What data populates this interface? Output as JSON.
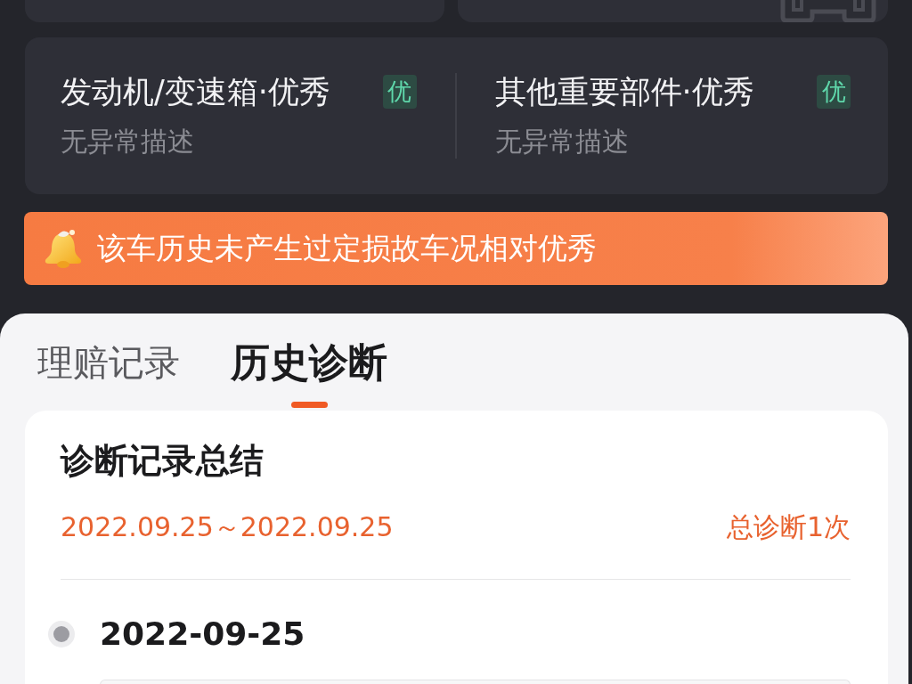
{
  "inspection": {
    "items": [
      {
        "title": "发动机/变速箱·优秀",
        "grade": "优",
        "description": "无异常描述"
      },
      {
        "title": "其他重要部件·优秀",
        "grade": "优",
        "description": "无异常描述"
      }
    ]
  },
  "notice": {
    "text": "该车历史未产生过定损故车况相对优秀"
  },
  "tabs": [
    {
      "label": "理赔记录",
      "selected": false
    },
    {
      "label": "历史诊断",
      "selected": true
    }
  ],
  "diagnosis_summary": {
    "title": "诊断记录总结",
    "date_range": "2022.09.25～2022.09.25",
    "total": "总诊断1次"
  },
  "records": [
    {
      "date": "2022-09-25"
    }
  ]
}
